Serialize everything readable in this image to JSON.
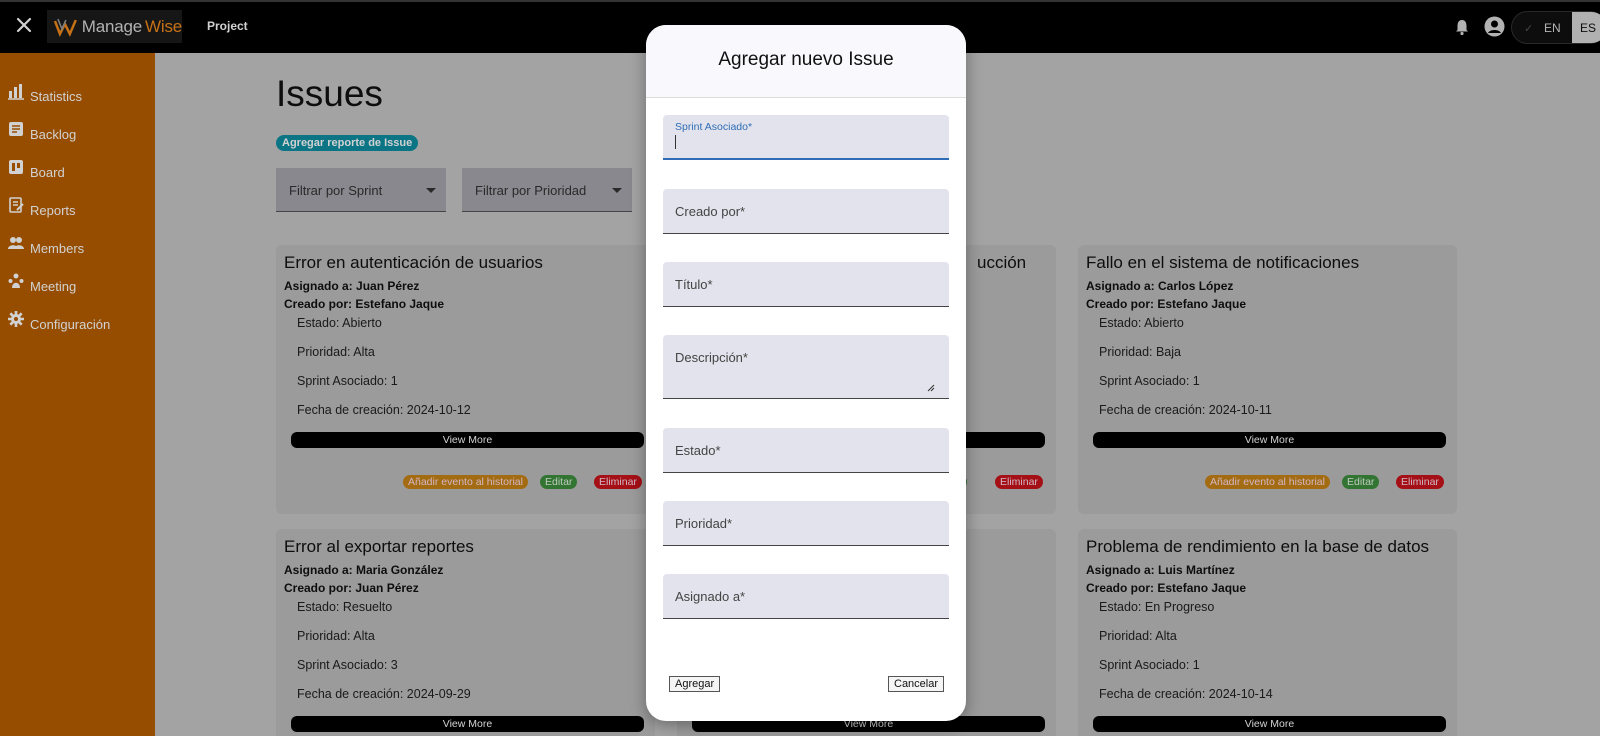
{
  "topbar": {
    "logo_part1": "Manage",
    "logo_part2": "Wise",
    "project_label": "Project",
    "lang_en": "EN",
    "lang_es": "ES",
    "check": "✓"
  },
  "sidebar": {
    "items": [
      {
        "label": "Statistics",
        "icon": "bar-chart-icon"
      },
      {
        "label": "Backlog",
        "icon": "backlog-icon"
      },
      {
        "label": "Board",
        "icon": "board-icon"
      },
      {
        "label": "Reports",
        "icon": "reports-icon"
      },
      {
        "label": "Members",
        "icon": "members-icon"
      },
      {
        "label": "Meeting",
        "icon": "meeting-icon"
      },
      {
        "label": "Configuración",
        "icon": "gear-icon"
      }
    ]
  },
  "main": {
    "title": "Issues",
    "add_report": "Agregar reporte de Issue",
    "filter_sprint": "Filtrar por Sprint",
    "filter_priority": "Filtrar por Prioridad",
    "assigned_prefix": "Asignado a:",
    "created_prefix": "Creado por:",
    "view_more": "View More",
    "btn_history": "Añadir evento al historial",
    "btn_edit": "Editar",
    "btn_delete": "Eliminar",
    "cards": [
      {
        "title": "Error en autenticación de usuarios",
        "assigned": "Juan Pérez",
        "created": "Estefano Jaque",
        "estado": "Estado: Abierto",
        "prioridad": "Prioridad: Alta",
        "sprint": "Sprint Asociado: 1",
        "fecha": "Fecha de creación: 2024-10-12"
      },
      {
        "title": "ucción"
      },
      {
        "title": "Fallo en el sistema de notificaciones",
        "assigned": "Carlos López",
        "created": "Estefano Jaque",
        "estado": "Estado: Abierto",
        "prioridad": "Prioridad: Baja",
        "sprint": "Sprint Asociado: 1",
        "fecha": "Fecha de creación: 2024-10-11"
      },
      {
        "title": "Error al exportar reportes",
        "assigned": "Maria González",
        "created": "Juan Pérez",
        "estado": "Estado: Resuelto",
        "prioridad": "Prioridad: Alta",
        "sprint": "Sprint Asociado: 3",
        "fecha": "Fecha de creación: 2024-09-29"
      },
      {
        "title": ""
      },
      {
        "title": "Problema de rendimiento en la base de datos",
        "assigned": "Luis Martínez",
        "created": "Estefano Jaque",
        "estado": "Estado: En Progreso",
        "prioridad": "Prioridad: Alta",
        "sprint": "Sprint Asociado: 1",
        "fecha": "Fecha de creación: 2024-10-14"
      }
    ],
    "partial_edit": "ar"
  },
  "modal": {
    "title": "Agregar nuevo Issue",
    "fields": {
      "sprint": {
        "label": "Sprint Asociado*",
        "value": ""
      },
      "creado": {
        "label": "Creado por*",
        "value": ""
      },
      "titulo": {
        "label": "Título*",
        "value": ""
      },
      "descripcion": {
        "label": "Descripción*",
        "value": ""
      },
      "estado": {
        "label": "Estado*",
        "value": ""
      },
      "prioridad": {
        "label": "Prioridad*",
        "value": ""
      },
      "asignado": {
        "label": "Asignado a*",
        "value": ""
      }
    },
    "btn_add": "Agregar",
    "btn_cancel": "Cancelar"
  }
}
